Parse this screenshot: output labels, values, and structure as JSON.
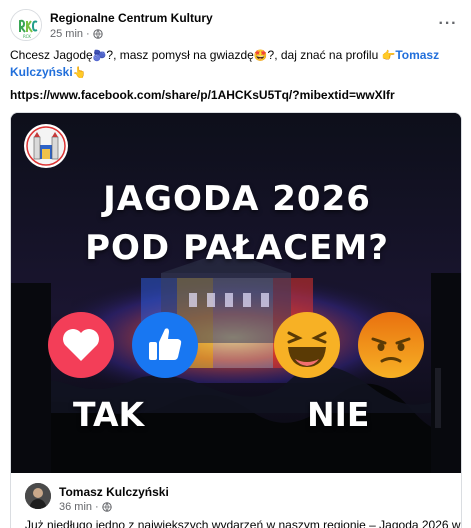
{
  "post": {
    "page_name": "Regionalne Centrum Kultury",
    "time": "25 min",
    "dot": "·",
    "more": "···",
    "caption_part1": "Chcesz Jagodę",
    "emoji1": "🫐",
    "caption_part2": "?, masz pomysł na gwiazdę",
    "emoji2": "🤩",
    "caption_part3": "?, daj znać na profilu ",
    "emoji3": "👉",
    "mention": "Tomasz Kulczyński",
    "emoji4": "👆",
    "link": "https://www.facebook.com/share/p/1AHCKsU5Tq/?mibextid=wwXIfr"
  },
  "shared": {
    "headline_line1": "JAGODA 2026",
    "headline_line2": "POD PAŁACEM?",
    "vote_yes": "TAK",
    "vote_no": "NIE",
    "author_name": "Tomasz Kulczyński",
    "author_time": "36 min",
    "dot": "·",
    "text": "Już niedługo jedno z największych wydarzeń w naszym regionie – Jagoda 2026 w"
  },
  "colors": {
    "mention": "#216fdb",
    "love": "#f33e58",
    "like": "#1877f2",
    "haha": "#f7b125",
    "angry": "#e9710f"
  },
  "icons": [
    "rck-logo-icon",
    "globe-icon",
    "more-icon",
    "love-reaction-icon",
    "like-reaction-icon",
    "haha-reaction-icon",
    "angry-reaction-icon",
    "city-crest-icon"
  ]
}
